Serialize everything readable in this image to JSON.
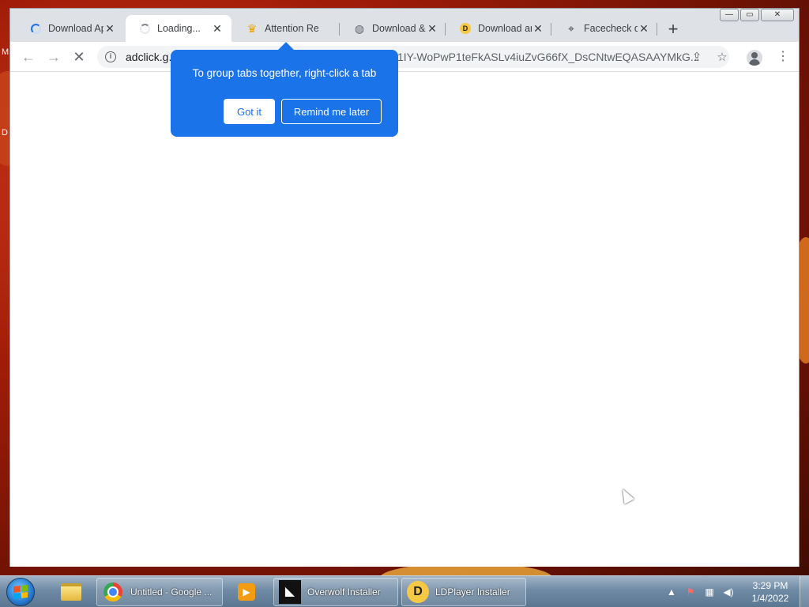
{
  "desktop": {
    "left_chars": [
      "M",
      "D"
    ]
  },
  "window_controls": {
    "minimize": "—",
    "maximize": "▭",
    "close": "✕"
  },
  "tabs": [
    {
      "title": "Download Ap",
      "icon": "spinner-icon",
      "close": "✕"
    },
    {
      "title": "Loading...",
      "icon": "spinner-icon",
      "close": "✕"
    },
    {
      "title": "Attention Re",
      "icon": "crown-icon",
      "close": "✕"
    },
    {
      "title": "Download &",
      "icon": "globe-icon",
      "close": "✕"
    },
    {
      "title": "Download ar",
      "icon": "ldplayer-icon",
      "close": "✕"
    },
    {
      "title": "Facecheck de",
      "icon": "tag-icon",
      "close": "✕"
    }
  ],
  "new_tab": "+",
  "toolbar": {
    "back": "←",
    "forward": "→",
    "stop": "✕",
    "url_start": "adclick.g.",
    "url_end": "1IY-WoPwP1teFkASLv4iuZvG66fX_DsCNtwEQASAAYMkG...",
    "share": "⇪",
    "bookmark": "☆",
    "menu": "⋮"
  },
  "bubble": {
    "text": "To group tabs together, right-click a tab",
    "got_it": "Got it",
    "remind_later": "Remind me later"
  },
  "taskbar": {
    "items": [
      {
        "label": "Untitled - Google ...",
        "icon": "chrome-icon"
      },
      {
        "label": "Overwolf Installer",
        "icon": "overwolf-icon"
      },
      {
        "label": "LDPlayer Installer",
        "icon": "ldplayer-icon"
      }
    ],
    "clock_time": "3:29 PM",
    "clock_date": "1/4/2022"
  },
  "colors": {
    "accent": "#1a73e8",
    "tab_strip": "#dee1e6"
  }
}
